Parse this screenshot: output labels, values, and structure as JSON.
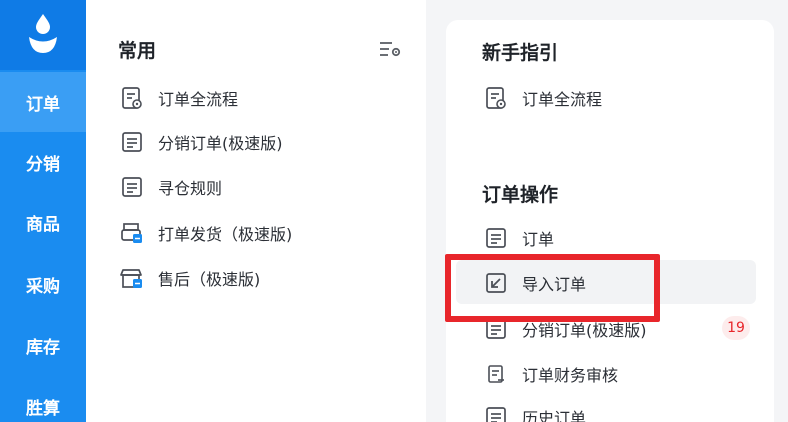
{
  "sidebar": {
    "items": [
      {
        "label": "订单"
      },
      {
        "label": "分销"
      },
      {
        "label": "商品"
      },
      {
        "label": "采购"
      },
      {
        "label": "库存"
      },
      {
        "label": "胜算"
      }
    ]
  },
  "common": {
    "title": "常用",
    "items": [
      {
        "label": "订单全流程"
      },
      {
        "label": "分销订单(极速版)"
      },
      {
        "label": "寻仓规则"
      },
      {
        "label": "打单发货（极速版)"
      },
      {
        "label": "售后（极速版)"
      }
    ]
  },
  "guide": {
    "title": "新手指引",
    "items": [
      {
        "label": "订单全流程"
      }
    ]
  },
  "order_ops": {
    "title": "订单操作",
    "items": [
      {
        "label": "订单"
      },
      {
        "label": "导入订单"
      },
      {
        "label": "分销订单(极速版)",
        "badge": "19"
      },
      {
        "label": "订单财务审核"
      },
      {
        "label": "历史订单"
      }
    ]
  },
  "colors": {
    "rail": "#1a8cf0",
    "rail_active": "#3a9ef4",
    "highlight_border": "#e8262b"
  }
}
